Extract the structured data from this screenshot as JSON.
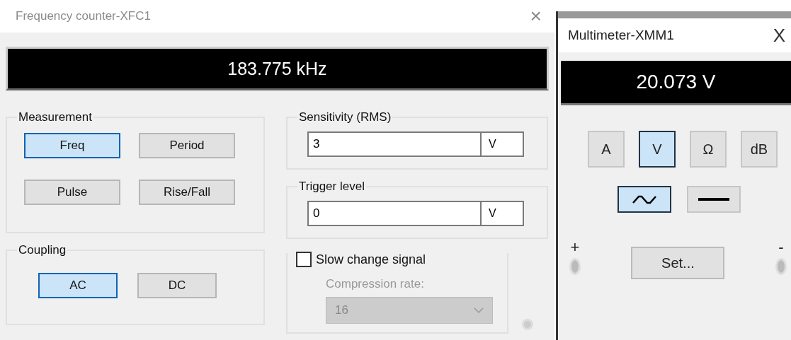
{
  "frequency_counter": {
    "title": "Frequency counter-XFC1",
    "close": "×",
    "display": "183.775 kHz",
    "measurement": {
      "label": "Measurement",
      "buttons": [
        {
          "label": "Freq",
          "selected": true
        },
        {
          "label": "Period",
          "selected": false
        },
        {
          "label": "Pulse",
          "selected": false
        },
        {
          "label": "Rise/Fall",
          "selected": false
        }
      ]
    },
    "coupling": {
      "label": "Coupling",
      "buttons": [
        {
          "label": "AC",
          "selected": true
        },
        {
          "label": "DC",
          "selected": false
        }
      ]
    },
    "sensitivity": {
      "label": "Sensitivity (RMS)",
      "value": "3",
      "unit": "V"
    },
    "trigger": {
      "label": "Trigger level",
      "value": "0",
      "unit": "V"
    },
    "slow_change": {
      "label": "Slow change signal",
      "checked": false
    },
    "compression": {
      "label": "Compression rate:",
      "value": "16",
      "disabled": true
    }
  },
  "multimeter": {
    "title": "Multimeter-XMM1",
    "close": "X",
    "display": "20.073 V",
    "modes": [
      {
        "label": "A",
        "selected": false
      },
      {
        "label": "V",
        "selected": true
      },
      {
        "label": "Ω",
        "selected": false
      },
      {
        "label": "dB",
        "selected": false
      }
    ],
    "signal_types": [
      {
        "kind": "ac",
        "selected": true
      },
      {
        "kind": "dc",
        "selected": false
      }
    ],
    "set_button": "Set...",
    "plus": "+",
    "minus": "-"
  }
}
